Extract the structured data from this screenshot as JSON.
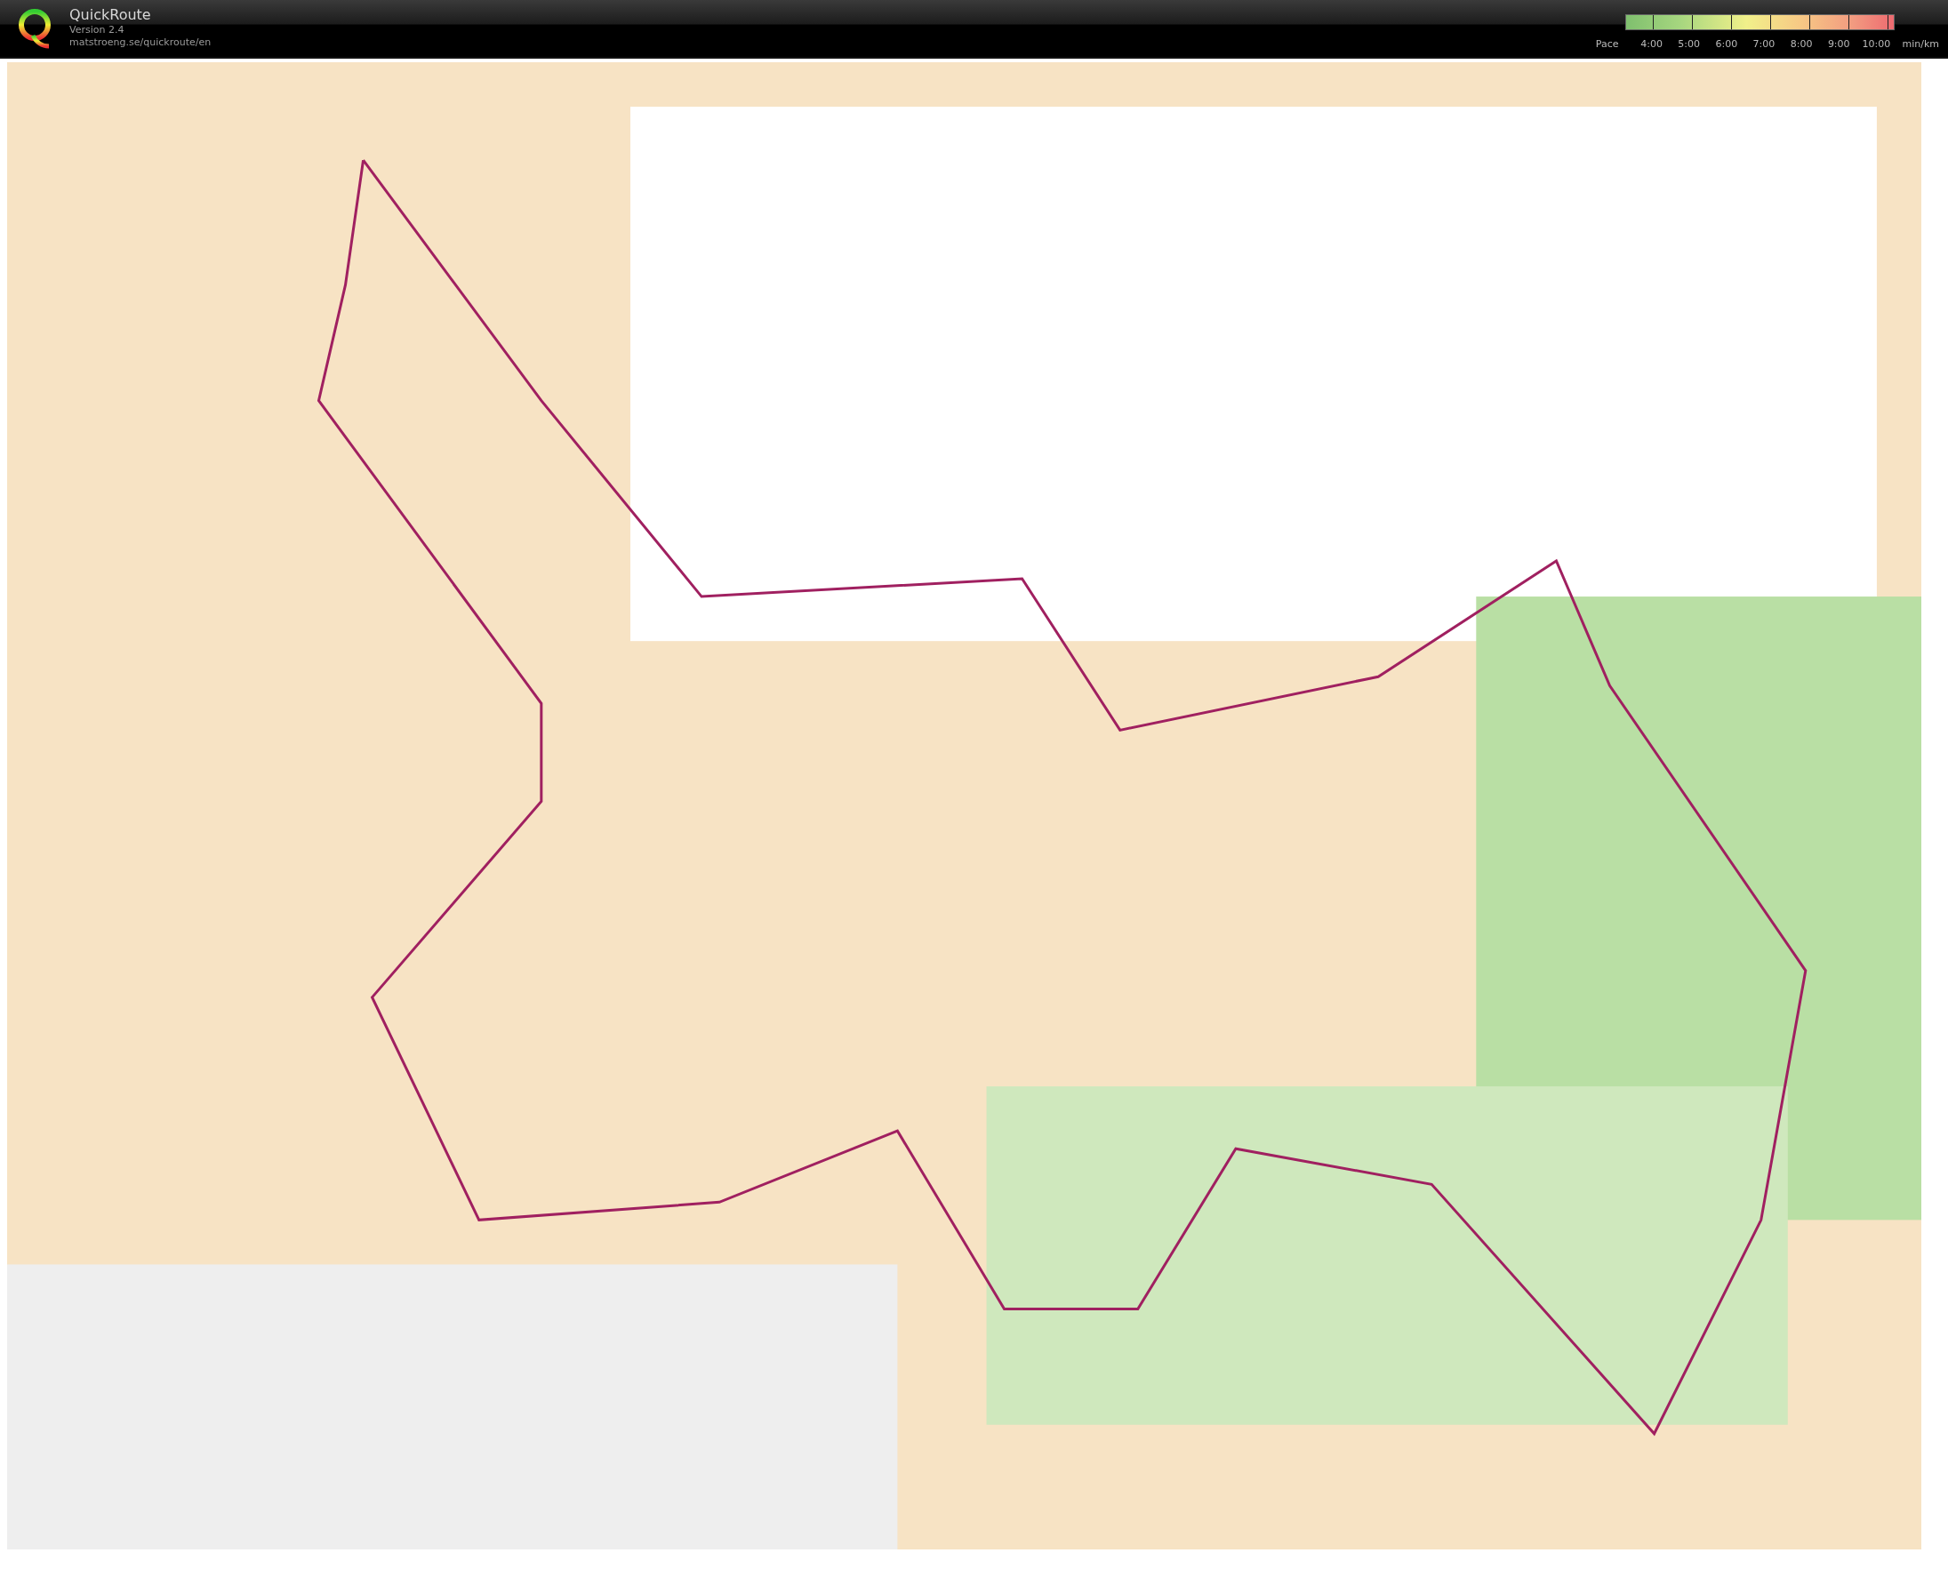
{
  "header": {
    "app_name": "QuickRoute",
    "version": "Version 2.4",
    "url": "matstroeng.se/quickroute/en"
  },
  "pace_legend": {
    "label": "Pace",
    "ticks": [
      "4:00",
      "5:00",
      "6:00",
      "7:00",
      "8:00",
      "9:00",
      "10:00"
    ],
    "unit": "min/km"
  }
}
